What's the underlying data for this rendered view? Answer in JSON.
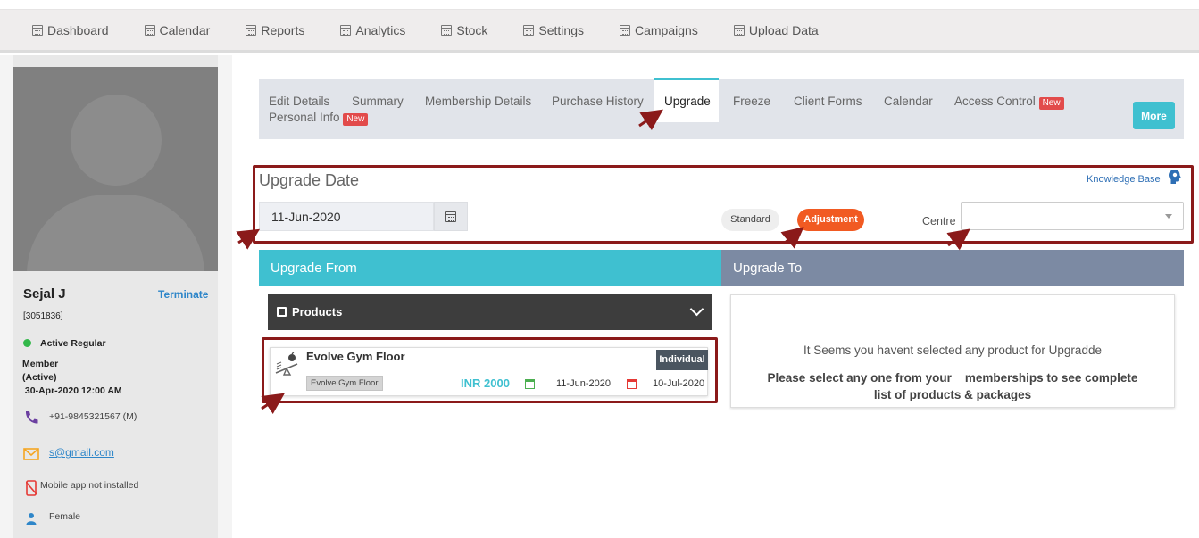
{
  "topnav": {
    "items": [
      {
        "label": "Dashboard",
        "icon": "calendar-icon"
      },
      {
        "label": "Calendar",
        "icon": "calendar-icon"
      },
      {
        "label": "Reports",
        "icon": "calendar-icon"
      },
      {
        "label": "Analytics",
        "icon": "calendar-icon"
      },
      {
        "label": "Stock",
        "icon": "calendar-icon"
      },
      {
        "label": "Settings",
        "icon": "calendar-icon"
      },
      {
        "label": "Campaigns",
        "icon": "calendar-icon"
      },
      {
        "label": "Upload Data",
        "icon": "calendar-icon"
      }
    ]
  },
  "client": {
    "name": "Sejal J",
    "terminate_label": "Terminate",
    "id": "[3051836]",
    "status": "Active Regular",
    "member_lines": [
      "Member",
      "(Active)",
      " 30-Apr-2020 12:00 AM"
    ],
    "phone": "+91-9845321567 (M)",
    "email": "s@gmail.com",
    "mobile_app": "Mobile app not installed",
    "gender": "Female",
    "status_color": "#33b84a"
  },
  "tabs": {
    "items": [
      "Edit Details",
      "Personal Info",
      "Summary",
      "Membership Details",
      "Purchase History",
      "Upgrade",
      "Freeze",
      "Client Forms",
      "Calendar",
      "Access Control"
    ],
    "new_badge": "New",
    "more_label": "More",
    "active": "Upgrade",
    "accent": "#3fc0d0"
  },
  "upgrade": {
    "date_title": "Upgrade Date",
    "knowledge_base": "Knowledge Base",
    "date_value": "11-Jun-2020",
    "standard_label": "Standard",
    "adjustment_label": "Adjustment",
    "centre_label": "Centre",
    "centre_value": "",
    "adjustment_color": "#f15a22",
    "from_title": "Upgrade From",
    "to_title": "Upgrade To",
    "products_label": "Products",
    "product": {
      "name": "Evolve Gym Floor",
      "tag": "Evolve Gym Floor",
      "price": "INR 2000",
      "start": "11-Jun-2020",
      "end": "10-Jul-2020",
      "type": "Individual"
    },
    "empty_msg": "It Seems you havent selected any product for Upgradde",
    "empty_hint": "Please select any one from your    memberships to see complete list of products & packages"
  }
}
